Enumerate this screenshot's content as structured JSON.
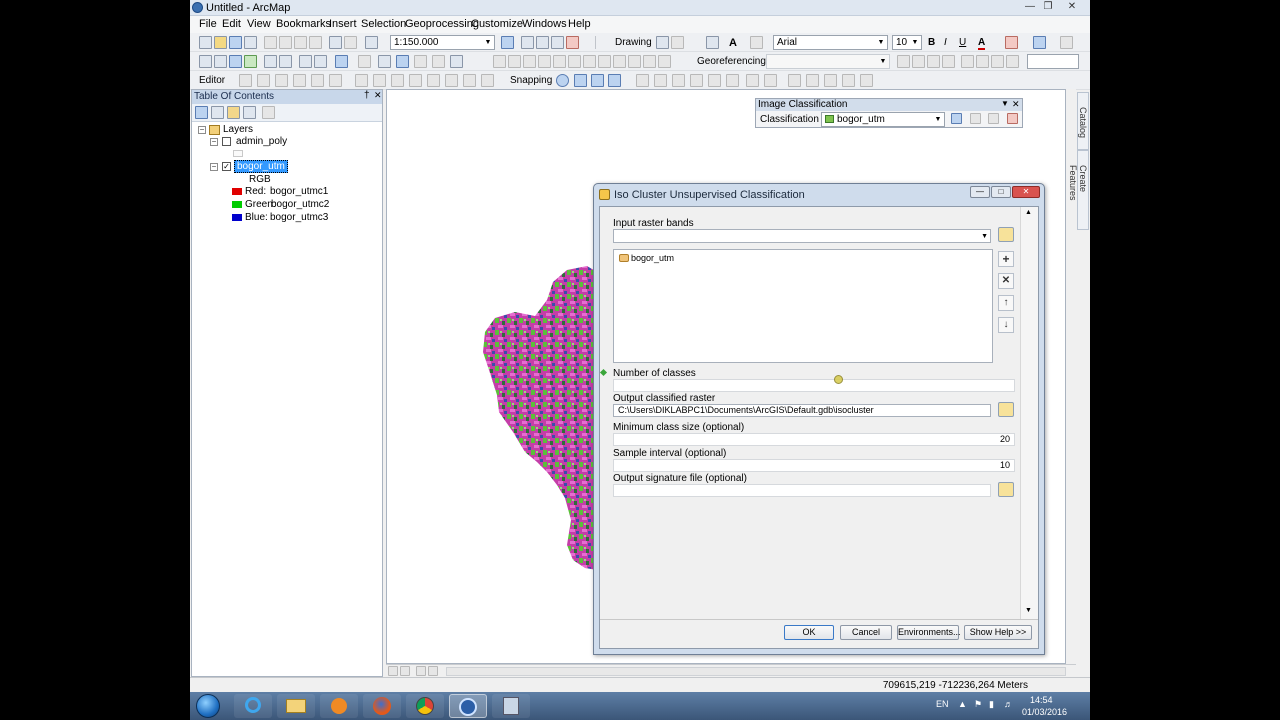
{
  "window": {
    "title": "Untitled - ArcMap"
  },
  "menu": [
    "File",
    "Edit",
    "View",
    "Bookmarks",
    "Insert",
    "Selection",
    "Geoprocessing",
    "Customize",
    "Windows",
    "Help"
  ],
  "toolbar": {
    "scale": "1:150.000",
    "drawing_label": "Drawing",
    "font_name": "Arial",
    "font_size": "10",
    "bold": "B",
    "italic": "I",
    "underline": "U",
    "text_color": "A",
    "georef_label": "Georeferencing",
    "editor_label": "Editor",
    "snapping_label": "Snapping"
  },
  "toc": {
    "title": "Table Of Contents",
    "pin": "†",
    "close": "✕",
    "root": "Layers",
    "layer1": "admin_poly",
    "layer2": "bogor_utm",
    "render": "RGB",
    "bands": [
      {
        "label": "Red:",
        "value": "bogor_utmc1",
        "color": "#e00000"
      },
      {
        "label": "Green:",
        "value": "bogor_utmc2",
        "color": "#00cc00"
      },
      {
        "label": "Blue:",
        "value": "bogor_utmc3",
        "color": "#0000cc"
      }
    ]
  },
  "image_classification": {
    "title": "Image Classification",
    "menu_label": "Classification",
    "layer": "bogor_utm"
  },
  "dock_tabs": {
    "catalog": "Catalog",
    "create_features": "Create Features"
  },
  "dialog": {
    "title": "Iso Cluster Unsupervised Classification",
    "input_label": "Input raster bands",
    "input_list": [
      "bogor_utm"
    ],
    "classes_label": "Number of classes",
    "classes_value": "",
    "output_label": "Output classified raster",
    "output_value": "C:\\Users\\DIKLABPC1\\Documents\\ArcGIS\\Default.gdb\\isocluster",
    "min_label": "Minimum class size (optional)",
    "min_value": "20",
    "sample_label": "Sample interval (optional)",
    "sample_value": "10",
    "signature_label": "Output signature file (optional)",
    "signature_value": "",
    "ok": "OK",
    "cancel": "Cancel",
    "environments": "Environments...",
    "show_help": "Show Help >>"
  },
  "status": {
    "coords": "709615,219  -712236,264 Meters"
  },
  "taskbar": {
    "lang": "EN",
    "time": "14:54",
    "date": "01/03/2016"
  }
}
